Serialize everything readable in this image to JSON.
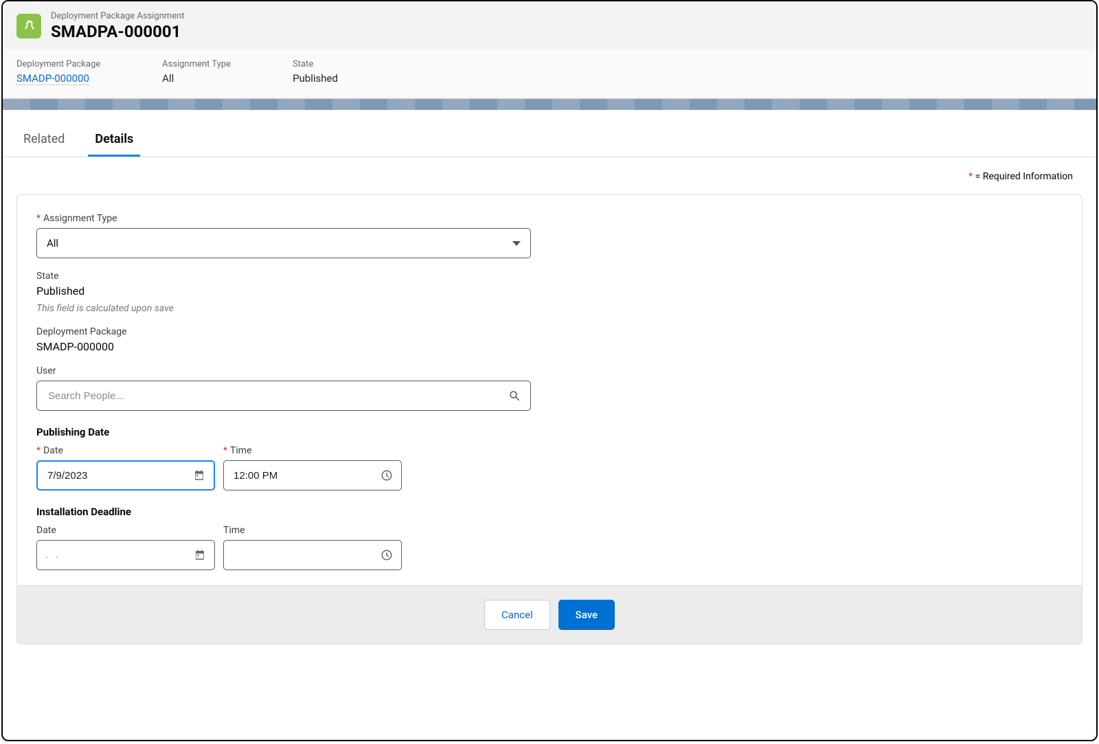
{
  "header": {
    "object_label": "Deployment Package Assignment",
    "record_title": "SMADPA-000001"
  },
  "highlights": {
    "deployment_package": {
      "label": "Deployment Package",
      "value": "SMADP-000000"
    },
    "assignment_type": {
      "label": "Assignment Type",
      "value": "All"
    },
    "state": {
      "label": "State",
      "value": "Published"
    }
  },
  "tabs": {
    "related": "Related",
    "details": "Details"
  },
  "required_note": "= Required Information",
  "form": {
    "assignment_type": {
      "label": "Assignment Type",
      "value": "All",
      "required": true
    },
    "state": {
      "label": "State",
      "value": "Published",
      "hint": "This field is calculated upon save"
    },
    "deployment_package": {
      "label": "Deployment Package",
      "value": "SMADP-000000"
    },
    "user": {
      "label": "User",
      "placeholder": "Search People..."
    },
    "publishing_date": {
      "section": "Publishing Date",
      "date": {
        "label": "Date",
        "value": "7/9/2023",
        "required": true
      },
      "time": {
        "label": "Time",
        "value": "12:00 PM",
        "required": true
      }
    },
    "installation_deadline": {
      "section": "Installation Deadline",
      "date": {
        "label": "Date",
        "value": ""
      },
      "time": {
        "label": "Time",
        "value": ""
      }
    }
  },
  "buttons": {
    "cancel": "Cancel",
    "save": "Save"
  }
}
